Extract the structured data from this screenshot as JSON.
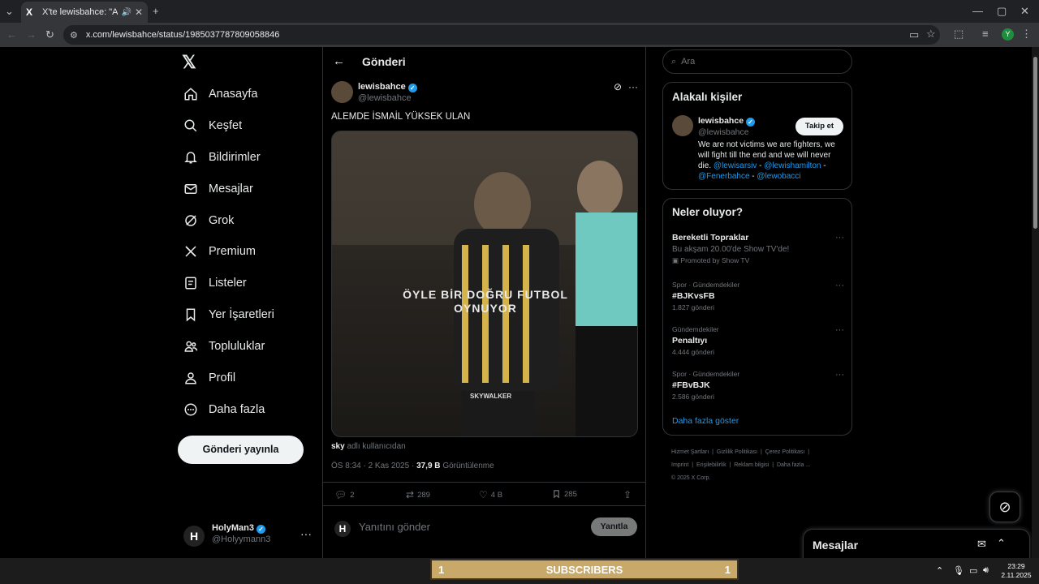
{
  "browser": {
    "tab_title": "X'te lewisbahce: \"ALEMDE İ",
    "url": "x.com/lewisbahce/status/1985037787809058846",
    "profile_initial": "Y"
  },
  "nav": {
    "items": [
      {
        "label": "Anasayfa",
        "icon": "home-icon"
      },
      {
        "label": "Keşfet",
        "icon": "search-icon"
      },
      {
        "label": "Bildirimler",
        "icon": "bell-icon"
      },
      {
        "label": "Mesajlar",
        "icon": "mail-icon"
      },
      {
        "label": "Grok",
        "icon": "grok-icon"
      },
      {
        "label": "Premium",
        "icon": "x-icon"
      },
      {
        "label": "Listeler",
        "icon": "list-icon"
      },
      {
        "label": "Yer İşaretleri",
        "icon": "bookmark-icon"
      },
      {
        "label": "Topluluklar",
        "icon": "people-icon"
      },
      {
        "label": "Profil",
        "icon": "person-icon"
      },
      {
        "label": "Daha fazla",
        "icon": "more-circle-icon"
      }
    ],
    "post_button": "Gönderi yayınla",
    "account": {
      "name": "HolyMan3",
      "handle": "@Holyymann3",
      "initial": "H"
    }
  },
  "post": {
    "header_title": "Gönderi",
    "author_name": "lewisbahce",
    "author_handle": "@lewisbahce",
    "text": "ALEMDE İSMAİL YÜKSEK ULAN",
    "media_overlay_line1": "ÖYLE BİR DOĞRU FUTBOL",
    "media_overlay_line2": "OYNUYOR",
    "media_watermark": "SKYWALKER",
    "source_user": "sky",
    "source_suffix": "adlı kullanıcıdan",
    "timestamp": "ÖS 8:34 · 2 Kas 2025 ·",
    "views": "37,9 B",
    "views_label": "Görüntülenme",
    "replies": "2",
    "reposts": "289",
    "likes": "4 B",
    "bookmarks": "285",
    "reply_placeholder": "Yanıtını gönder",
    "reply_button": "Yanıtla"
  },
  "right": {
    "search_placeholder": "Ara",
    "related_title": "Alakalı kişiler",
    "related": {
      "name": "lewisbahce",
      "handle": "@lewisbahce",
      "follow": "Takip et",
      "bio_text": "We are not victims we are fighters, we will fight till the end and we will never die.",
      "bio_link1": "@lewisarsiv",
      "bio_sep1": " - ",
      "bio_link2": "@lewishamilton",
      "bio_sep2": " -",
      "bio_link3": "@Fenerbahce",
      "bio_sep3": " - ",
      "bio_link4": "@lewobacci"
    },
    "trends_title": "Neler oluyor?",
    "trends": [
      {
        "category": "",
        "title": "Bereketli Topraklar",
        "subtitle": "Bu akşam 20.00'de Show TV'de!",
        "count": "Promoted by Show TV"
      },
      {
        "category": "Spor · Gündemdekiler",
        "title": "#BJKvsFB",
        "subtitle": "",
        "count": "1.827 gönderi"
      },
      {
        "category": "Gündemdekiler",
        "title": "Penaltıyı",
        "subtitle": "",
        "count": "4.444 gönderi"
      },
      {
        "category": "Spor · Gündemdekiler",
        "title": "#FBvBJK",
        "subtitle": "",
        "count": "2.586 gönderi"
      }
    ],
    "show_more": "Daha fazla göster",
    "footer": {
      "l1": "Hizmet Şartları",
      "l2": "Gizlilik Politikası",
      "l3": "Çerez Politikası",
      "l4": "Imprint",
      "l5": "Erişilebilirlik",
      "l6": "Reklam bilgisi",
      "l7": "Daha fazla ...",
      "copyright": "© 2025 X Corp."
    }
  },
  "dock": {
    "title": "Mesajlar"
  },
  "taskbar": {
    "subs_left": "1",
    "subs_label": "SUBSCRIBERS",
    "subs_right": "1",
    "time": "23:29",
    "date": "2.11.2025"
  },
  "colors": {
    "accent": "#1d9bf0",
    "background": "#000000",
    "border": "#2f3336",
    "muted": "#71767b"
  }
}
